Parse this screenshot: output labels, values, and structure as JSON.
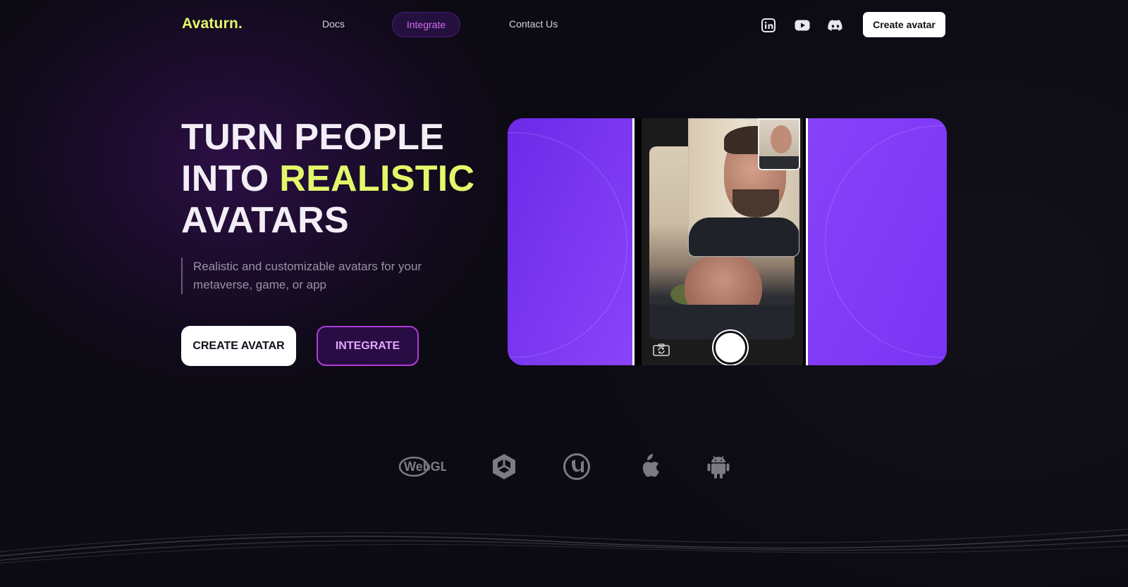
{
  "nav": {
    "logo": "Avaturn.",
    "links": [
      {
        "label": "Docs"
      },
      {
        "label": "Integrate"
      },
      {
        "label": "Contact Us"
      }
    ],
    "social": [
      "linkedin-icon",
      "youtube-icon",
      "discord-icon"
    ],
    "cta_label": "Create avatar"
  },
  "hero": {
    "title_line1": "TURN PEOPLE",
    "title_line2_a": "INTO ",
    "title_line2_b": "REALISTIC",
    "title_line3": "AVATARS",
    "subtitle": "Realistic and customizable avatars for your metaverse, game, or app",
    "primary_button": "CREATE AVATAR",
    "secondary_button": "INTEGRATE"
  },
  "platforms": [
    "webgl-logo",
    "unity-logo",
    "unreal-logo",
    "apple-logo",
    "android-logo"
  ],
  "platform_labels": {
    "webgl": "WebGL"
  },
  "colors": {
    "accent_yellow": "#e2f86a",
    "accent_purple": "#8b44fa",
    "integrate_pink": "#d56cf2",
    "background": "#0c0a12"
  }
}
